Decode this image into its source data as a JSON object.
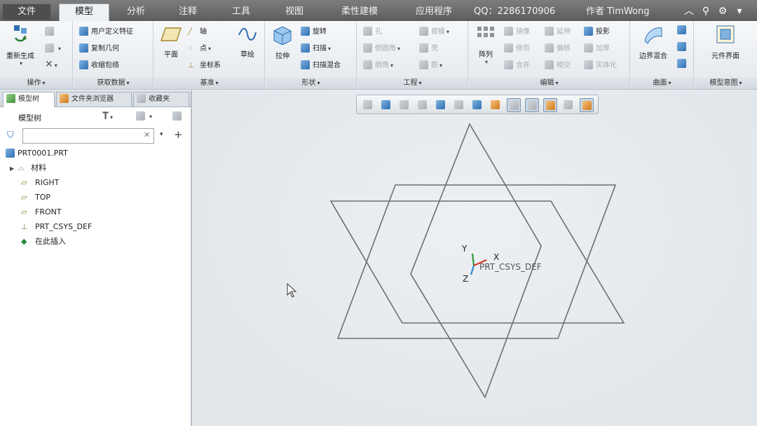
{
  "menu": {
    "tabs": [
      {
        "label": "文件",
        "active": false
      },
      {
        "label": "模型",
        "active": true
      },
      {
        "label": "分析",
        "active": false
      },
      {
        "label": "注释",
        "active": false
      },
      {
        "label": "工具",
        "active": false
      },
      {
        "label": "视图",
        "active": false
      },
      {
        "label": "柔性建模",
        "active": false
      },
      {
        "label": "应用程序",
        "active": false
      }
    ],
    "qq_text": "QQ：2286170906",
    "author_text": "作者 TimWong",
    "icons": [
      "chevron-up-icon",
      "search-icon",
      "gear-icon",
      "chevron-down-icon"
    ]
  },
  "ribbon": {
    "groups": {
      "operations": {
        "title": "操作",
        "regenerate": "重新生成",
        "small": [
          "copy-icon",
          "paste-icon",
          "delete-icon"
        ]
      },
      "get_data": {
        "title": "获取数据",
        "items": [
          "用户定义特征",
          "复制几何",
          "收缩包络"
        ]
      },
      "datum": {
        "title": "基准",
        "plane": "平面",
        "axis": "轴",
        "point": "点",
        "csys": "坐标系",
        "sketch": "草绘"
      },
      "shapes": {
        "title": "形状",
        "extrude": "拉伸",
        "revolve": "旋转",
        "sweep": "扫描",
        "swept_blend": "扫描混合"
      },
      "engineering": {
        "title": "工程",
        "items": [
          "孔",
          "倒圆角",
          "倒角",
          "拔模",
          "壳",
          "筋"
        ]
      },
      "editing": {
        "title": "编辑",
        "pattern": "阵列",
        "items": [
          "镜像",
          "修剪",
          "合并",
          "延伸",
          "偏移",
          "相交",
          "投影",
          "加厚",
          "实体化"
        ]
      },
      "surfaces": {
        "title": "曲面",
        "boundary_blend": "边界混合"
      },
      "model_intent": {
        "title": "模型意图",
        "component_interface": "元件界面"
      }
    }
  },
  "left_panel": {
    "tabs": [
      "模型树",
      "文件夹浏览器",
      "收藏夹"
    ],
    "tree_title": "模型树",
    "filter": {
      "value": "",
      "placeholder": ""
    },
    "tree_items": [
      {
        "label": "PRT0001.PRT",
        "icon": "part-icon"
      },
      {
        "label": "材料",
        "icon": "material-icon"
      },
      {
        "label": "RIGHT",
        "icon": "datum-plane-icon"
      },
      {
        "label": "TOP",
        "icon": "datum-plane-icon"
      },
      {
        "label": "FRONT",
        "icon": "datum-plane-icon"
      },
      {
        "label": "PRT_CSYS_DEF",
        "icon": "csys-icon"
      },
      {
        "label": "在此插入",
        "icon": "insert-here-icon"
      }
    ]
  },
  "graphics": {
    "csys_label": "PRT_CSYS_DEF",
    "axis_labels": {
      "x": "X",
      "y": "Y",
      "z": "Z"
    },
    "view_toolbar_icons": [
      "refit-icon",
      "zoom-in-icon",
      "zoom-out-icon",
      "repaint-icon",
      "display-style-icon",
      "saved-orientations-icon",
      "view-manager-icon",
      "datum-display-icon",
      "spin-center-icon",
      "annotation-display-icon",
      "datum-plane-display-icon",
      "csys-display-icon",
      "point-display-icon"
    ]
  }
}
